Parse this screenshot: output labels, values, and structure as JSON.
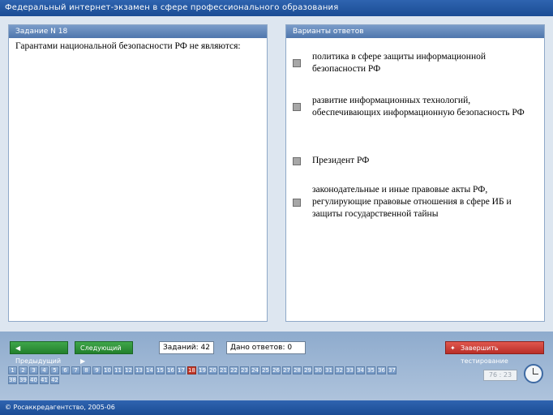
{
  "title": "Федеральный интернет-экзамен в сфере профессионального образования",
  "task": {
    "header": "Задание N 18",
    "question": "Гарантами национальной безопасности РФ не являются:"
  },
  "answers_panel": {
    "header": "Варианты ответов",
    "options": [
      "политика в сфере защиты информационной безопасности РФ",
      "развитие информационных технологий, обеспечивающих информационную безопасность РФ",
      "Президент РФ",
      "законодательные и иные правовые акты РФ, регулирующие правовые отношения в сфере ИБ и защиты государственной тайны"
    ]
  },
  "nav": {
    "prev": "Предыдущий",
    "next": "Следующий",
    "tasks_count": "Заданий: 42",
    "answers_given": "Дано ответов: 0",
    "finish": "Завершить тестирование"
  },
  "pages": [
    "1",
    "2",
    "3",
    "4",
    "5",
    "6",
    "7",
    "8",
    "9",
    "10",
    "11",
    "12",
    "13",
    "14",
    "15",
    "16",
    "17",
    "18",
    "19",
    "20",
    "21",
    "22",
    "23",
    "24",
    "25",
    "26",
    "27",
    "28",
    "29",
    "30",
    "31",
    "32",
    "33",
    "34",
    "35",
    "36",
    "37",
    "38",
    "39",
    "40",
    "41",
    "42"
  ],
  "active_page": "18",
  "timer": "76 : 23",
  "footer": "© Росаккредагентство, 2005-06",
  "colors": {
    "accent": "#1b4c94",
    "active_page": "#c0392b",
    "button_green": "#22802c",
    "button_red": "#b92e28"
  },
  "icons": {
    "prev": "triangle-left-icon",
    "next": "triangle-right-icon",
    "finish": "running-man-icon",
    "clock": "clock-icon"
  }
}
